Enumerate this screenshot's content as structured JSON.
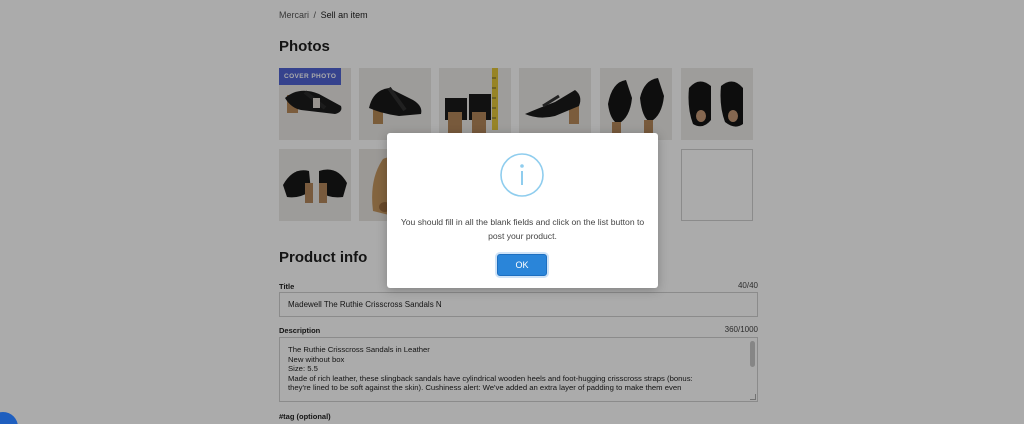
{
  "breadcrumb": {
    "root": "Mercari",
    "separator": "/",
    "current": "Sell an item"
  },
  "photos": {
    "title": "Photos",
    "cover_badge": "COVER PHOTO",
    "items": [
      {
        "icon": "black-slingback-sandal-photo"
      },
      {
        "icon": "black-slingback-sandal-side-photo"
      },
      {
        "icon": "sandal-heel-measurement-photo"
      },
      {
        "icon": "black-slingback-sandal-profile-photo"
      },
      {
        "icon": "black-sandals-pair-photo"
      },
      {
        "icon": "black-sandals-pair-front-photo"
      },
      {
        "icon": "black-sandals-pair-back-photo"
      },
      {
        "icon": "sandal-sole-photo"
      },
      {
        "icon": "empty-photo-slot"
      }
    ]
  },
  "product_info": {
    "title": "Product info",
    "title_field": {
      "label": "Title",
      "count": "40/40",
      "value": "Madewell The Ruthie Crisscross Sandals N"
    },
    "description": {
      "label": "Description",
      "count": "360/1000",
      "lines": [
        "The Ruthie Crisscross Sandals in Leather",
        "New without box",
        "Size: 5.5",
        "Made of rich leather, these slingback sandals have cylindrical wooden heels and foot-hugging crisscross straps (bonus:",
        "they're lined to be soft against the skin). Cushiness alert: We've added an extra layer of padding to make them even"
      ]
    },
    "tag_label": "#tag (optional)"
  },
  "modal": {
    "icon": "info-icon",
    "message": "You should fill in all the blank fields and click on the list button to post your product.",
    "ok_label": "OK"
  },
  "colors": {
    "accent": "#2a85d9",
    "cover_badge": "#4f63d2",
    "info_icon": "#8fcdee",
    "overlay": "rgba(0,0,0,0.33)"
  }
}
